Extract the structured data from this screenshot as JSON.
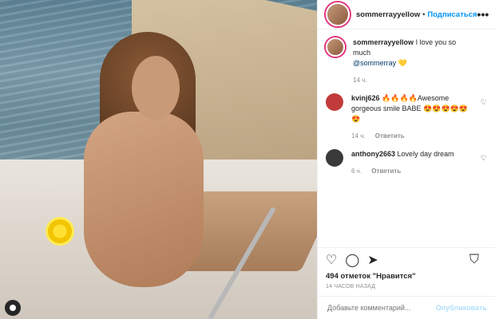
{
  "header": {
    "username": "sommerrayyellow",
    "separator": "•",
    "follow_label": "Подписаться",
    "more_icon": "more-dots-icon"
  },
  "caption": {
    "username": "sommerrayyellow",
    "text": "I love you so much",
    "mention": "@sommerray",
    "emoji": "💛",
    "time": "14 ч."
  },
  "comments": [
    {
      "username": "kvinj626",
      "text": "🔥🔥🔥🔥Awesome gorgeous smile BABE 😍😍😍😍😍😍",
      "time": "14 ч.",
      "reply_label": "Ответить",
      "avatar_color": "#c23b3b"
    },
    {
      "username": "anthony2663",
      "text": "Lovely day dream",
      "time": "6 ч.",
      "reply_label": "Ответить",
      "avatar_color": "#3a3a3a"
    }
  ],
  "actions": {
    "like_icon": "heart-outline-icon",
    "comment_icon": "comment-icon",
    "share_icon": "share-icon",
    "save_icon": "bookmark-icon"
  },
  "likes": {
    "count_text": "494 отметок \"Нравится\""
  },
  "timestamp": "14 ЧАСОВ НАЗАД",
  "add_comment": {
    "placeholder": "Добавьте комментарий...",
    "post_label": "Опубликовать"
  },
  "colors": {
    "accent": "#0095f6",
    "post_disabled": "#b2dffc",
    "muted": "#8e8e8e"
  }
}
